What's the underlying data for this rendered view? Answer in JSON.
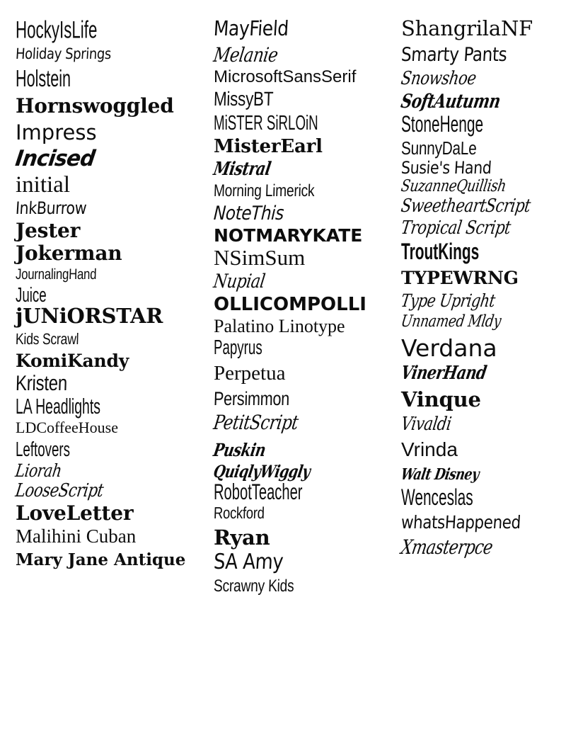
{
  "page": {
    "title": "Font Sample Sheet",
    "background_color": "#ffffff",
    "text_color": "#0d0d0d",
    "column_count": 3
  },
  "columns": [
    {
      "name": "column-1",
      "items": [
        {
          "label": "HockyIsLife",
          "size": 31,
          "style": "tall",
          "weight": "normal",
          "top_gap": 12
        },
        {
          "label": "Holiday Springs",
          "size": 21,
          "style": "hand",
          "weight": "normal",
          "top_gap": 9
        },
        {
          "label": "Holstein",
          "size": 30,
          "style": "tall",
          "weight": "normal",
          "top_gap": 10
        },
        {
          "label": "Hornswoggled",
          "size": 28,
          "style": "slab",
          "weight": "bold",
          "top_gap": 9
        },
        {
          "label": "Impress",
          "size": 29,
          "style": "d-sans",
          "weight": "normal",
          "top_gap": 9
        },
        {
          "label": "Incised",
          "size": 31,
          "style": "ital-blk",
          "weight": "bold",
          "top_gap": 7
        },
        {
          "label": "initial",
          "size": 33,
          "style": "f-serif",
          "weight": "normal",
          "top_gap": 5
        },
        {
          "label": "InkBurrow",
          "size": 24,
          "style": "hand",
          "weight": "normal",
          "top_gap": 4
        },
        {
          "label": "Jester",
          "size": 28,
          "style": "slab",
          "weight": "bold",
          "top_gap": 6
        },
        {
          "label": "Jokerman",
          "size": 28,
          "style": "slab",
          "weight": "bold",
          "top_gap": 4
        },
        {
          "label": "JournalingHand",
          "size": 21,
          "style": "hand2",
          "weight": "normal",
          "top_gap": 5
        },
        {
          "label": "Juice",
          "size": 26,
          "style": "tall",
          "weight": "normal",
          "top_gap": 5
        },
        {
          "label": "jUNiORSTAR",
          "size": 29,
          "style": "slab",
          "weight": "bold",
          "top_gap": 3
        },
        {
          "label": "Kids Scrawl",
          "size": 22,
          "style": "hand2",
          "weight": "normal",
          "top_gap": 7
        },
        {
          "label": "KomiKandy",
          "size": 25,
          "style": "slab",
          "weight": "bold",
          "top_gap": 7
        },
        {
          "label": "Kristen",
          "size": 30,
          "style": "hand2",
          "weight": "normal",
          "top_gap": 5
        },
        {
          "label": "LA Headlights",
          "size": 27,
          "style": "tall",
          "weight": "normal",
          "top_gap": 4
        },
        {
          "label": "LDCoffeeHouse",
          "size": 22,
          "style": "f-serif",
          "weight": "normal",
          "top_gap": 5
        },
        {
          "label": "Leftovers",
          "size": 26,
          "style": "tall",
          "weight": "normal",
          "top_gap": 6
        },
        {
          "label": "Liorah",
          "size": 25,
          "style": "script",
          "weight": "normal",
          "top_gap": 5
        },
        {
          "label": "LooseScript",
          "size": 26,
          "style": "script",
          "weight": "normal",
          "top_gap": 3
        },
        {
          "label": "LoveLetter",
          "size": 28,
          "style": "slab",
          "weight": "bold",
          "top_gap": 5
        },
        {
          "label": "Malihini Cuban",
          "size": 27,
          "style": "f-serif",
          "weight": "normal",
          "top_gap": 5
        },
        {
          "label": "Mary Jane Antique",
          "size": 23,
          "style": "d-serif",
          "weight": "bold",
          "top_gap": 8
        }
      ]
    },
    {
      "name": "column-2",
      "items": [
        {
          "label": "MayField",
          "size": 29,
          "style": "hand",
          "weight": "normal",
          "top_gap": 12
        },
        {
          "label": "Melanie",
          "size": 28,
          "style": "script",
          "weight": "normal",
          "top_gap": 9
        },
        {
          "label": "MicrosoftSansSerif",
          "size": 24,
          "style": "f-sans",
          "weight": "normal",
          "top_gap": 5
        },
        {
          "label": "MissyBT",
          "size": 28,
          "style": "hand2",
          "weight": "normal",
          "top_gap": 5
        },
        {
          "label": "MiSTER SiRLOiN",
          "size": 26,
          "style": "tall",
          "weight": "normal",
          "top_gap": 6
        },
        {
          "label": "MisterEarl",
          "size": 26,
          "style": "slab",
          "weight": "bold",
          "top_gap": 8
        },
        {
          "label": "Mistral",
          "size": 26,
          "style": "script-b",
          "weight": "bold",
          "top_gap": 6
        },
        {
          "label": "Morning Limerick",
          "size": 24,
          "style": "hand2",
          "weight": "normal",
          "top_gap": 6
        },
        {
          "label": "NoteThis",
          "size": 27,
          "style": "ital-hand",
          "weight": "normal",
          "top_gap": 6
        },
        {
          "label": "NOTMARYKATE",
          "size": 25,
          "style": "d-sans",
          "weight": "bold",
          "top_gap": 5
        },
        {
          "label": "NSimSum",
          "size": 31,
          "style": "f-serif",
          "weight": "normal",
          "top_gap": 3
        },
        {
          "label": "Nupial",
          "size": 27,
          "style": "script",
          "weight": "normal",
          "top_gap": 5
        },
        {
          "label": "OLLICOMPOLLI",
          "size": 26,
          "style": "d-sans",
          "weight": "bold",
          "top_gap": 6
        },
        {
          "label": "Palatino Linotype",
          "size": 26,
          "style": "f-serif",
          "weight": "normal",
          "top_gap": 5
        },
        {
          "label": "Papyrus",
          "size": 26,
          "style": "tall",
          "weight": "normal",
          "top_gap": 3
        },
        {
          "label": "Perpetua",
          "size": 29,
          "style": "f-serif",
          "weight": "normal",
          "top_gap": 10
        },
        {
          "label": "Persimmon",
          "size": 27,
          "style": "hand2",
          "weight": "normal",
          "top_gap": 8
        },
        {
          "label": "PetitScript",
          "size": 28,
          "style": "script",
          "weight": "normal",
          "top_gap": 6
        },
        {
          "label": "Puskin",
          "size": 25,
          "style": "script-b",
          "weight": "bold",
          "top_gap": 12
        },
        {
          "label": "QuiqlyWiggly",
          "size": 24,
          "style": "script-b",
          "weight": "bold",
          "top_gap": 6
        },
        {
          "label": "RobotTeacher",
          "size": 28,
          "style": "tall",
          "weight": "normal",
          "top_gap": 3
        },
        {
          "label": "Rockford",
          "size": 23,
          "style": "hand2",
          "weight": "normal",
          "top_gap": 4
        },
        {
          "label": "Ryan",
          "size": 29,
          "style": "slab",
          "weight": "bold",
          "top_gap": 9
        },
        {
          "label": "SA Amy",
          "size": 30,
          "style": "hand",
          "weight": "normal",
          "top_gap": 5
        },
        {
          "label": "Scrawny Kids",
          "size": 24,
          "style": "hand2",
          "weight": "normal",
          "top_gap": 7
        }
      ]
    },
    {
      "name": "column-3",
      "items": [
        {
          "label": "ShangrilaNF",
          "size": 29,
          "style": "slab",
          "weight": "normal",
          "top_gap": 12
        },
        {
          "label": "Smarty Pants",
          "size": 27,
          "style": "hand",
          "weight": "normal",
          "top_gap": 9
        },
        {
          "label": "Snowshoe",
          "size": 26,
          "style": "script",
          "weight": "normal",
          "top_gap": 7
        },
        {
          "label": "SoftAutumn",
          "size": 27,
          "style": "script-b",
          "weight": "bold",
          "top_gap": 6
        },
        {
          "label": "StoneHenge",
          "size": 29,
          "style": "tall",
          "weight": "normal",
          "top_gap": 5
        },
        {
          "label": "SunnyDaLe",
          "size": 26,
          "style": "hand2",
          "weight": "normal",
          "top_gap": 5
        },
        {
          "label": "Susie's Hand",
          "size": 24,
          "style": "hand",
          "weight": "normal",
          "top_gap": 3
        },
        {
          "label": "SuzanneQuillish",
          "size": 23,
          "style": "script",
          "weight": "normal",
          "top_gap": 3
        },
        {
          "label": "SweetheartScript",
          "size": 26,
          "style": "script",
          "weight": "normal",
          "top_gap": 3
        },
        {
          "label": "Tropical Script",
          "size": 26,
          "style": "script",
          "weight": "normal",
          "top_gap": 5
        },
        {
          "label": "TroutKings",
          "size": 29,
          "style": "tall",
          "weight": "bold",
          "top_gap": 7
        },
        {
          "label": "TYPEWRNG",
          "size": 25,
          "style": "slab",
          "weight": "bold",
          "top_gap": 9
        },
        {
          "label": "Type Upright",
          "size": 25,
          "style": "script",
          "weight": "normal",
          "top_gap": 7
        },
        {
          "label": "Unnamed Mldy",
          "size": 23,
          "style": "script",
          "weight": "normal",
          "top_gap": 6
        },
        {
          "label": "Verdana",
          "size": 33,
          "style": "d-sans",
          "weight": "normal",
          "top_gap": 9
        },
        {
          "label": "VinerHand",
          "size": 26,
          "style": "script-b",
          "weight": "bold",
          "top_gap": 6
        },
        {
          "label": "Vinque",
          "size": 29,
          "style": "slab",
          "weight": "bold",
          "top_gap": 10
        },
        {
          "label": "Vivaldi",
          "size": 26,
          "style": "script",
          "weight": "normal",
          "top_gap": 7
        },
        {
          "label": "Vrinda",
          "size": 28,
          "style": "f-sans",
          "weight": "normal",
          "top_gap": 9
        },
        {
          "label": "Walt Disney",
          "size": 22,
          "style": "script-b",
          "weight": "bold",
          "top_gap": 10
        },
        {
          "label": "Wenceslas",
          "size": 29,
          "style": "tall",
          "weight": "normal",
          "top_gap": 8
        },
        {
          "label": "whatsHappened",
          "size": 25,
          "style": "hand",
          "weight": "normal",
          "top_gap": 7
        },
        {
          "label": "Xmasterpce",
          "size": 28,
          "style": "script-b",
          "weight": "normal",
          "top_gap": 9
        }
      ]
    }
  ]
}
